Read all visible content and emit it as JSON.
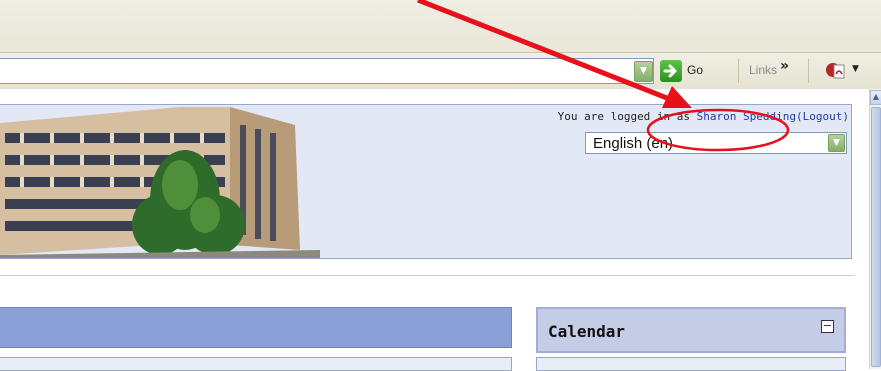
{
  "browser": {
    "go_label": "Go",
    "links_label": "Links",
    "links_chevron": "»",
    "dropdown_glyph": "▼"
  },
  "page": {
    "login_prefix": "You are logged in as",
    "user_name": "Sharon Spedding",
    "logout_label": "(Logout)",
    "language_value": "English (en)",
    "calendar_title": "Calendar",
    "calendar_toggle": "−"
  },
  "annotation": {
    "color": "#e8111b"
  }
}
